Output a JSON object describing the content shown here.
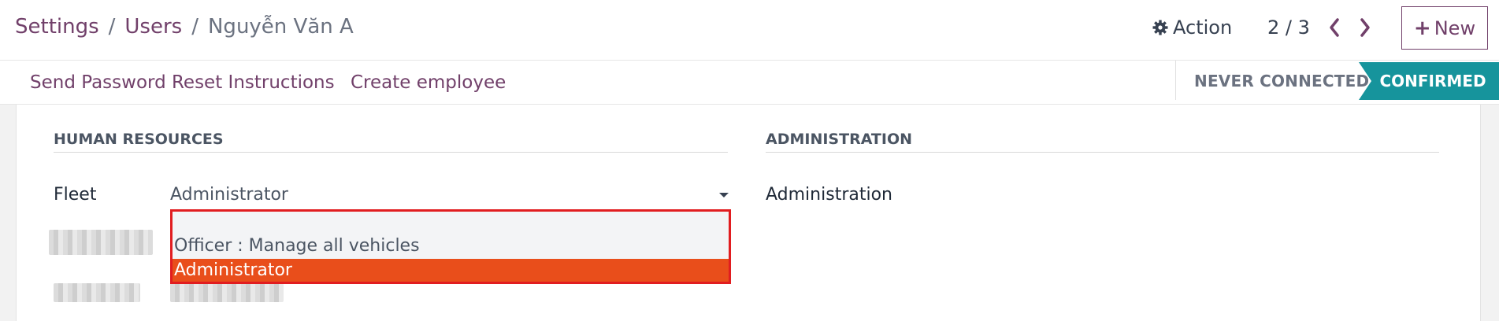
{
  "breadcrumb": {
    "items": [
      "Settings",
      "Users"
    ],
    "separator": "/",
    "current": "Nguyễn Văn A"
  },
  "toolbar": {
    "action_label": "Action",
    "pager": "2 / 3",
    "new_label": "New",
    "new_plus": "+"
  },
  "statusbar": {
    "buttons": [
      "Send Password Reset Instructions",
      "Create employee"
    ],
    "stages": [
      "NEVER CONNECTED",
      "CONFIRMED"
    ],
    "active_stage": "CONFIRMED"
  },
  "sections": {
    "hr": {
      "title": "HUMAN RESOURCES",
      "fleet_label": "Fleet",
      "fleet_value": "Administrator"
    },
    "admin": {
      "title": "ADMINISTRATION",
      "field_label": "Administration"
    }
  },
  "dropdown": {
    "options": [
      "",
      "Officer : Manage all vehicles",
      "Administrator"
    ],
    "selected": "Administrator"
  },
  "icons": {
    "action": "gear-icon",
    "prev": "chevron-left-icon",
    "next": "chevron-right-icon",
    "caret": "caret-down-icon"
  },
  "colors": {
    "brand": "#71406a",
    "stage_active": "#16949c",
    "highlight": "#e94e1b",
    "annotation": "#e11d20"
  }
}
